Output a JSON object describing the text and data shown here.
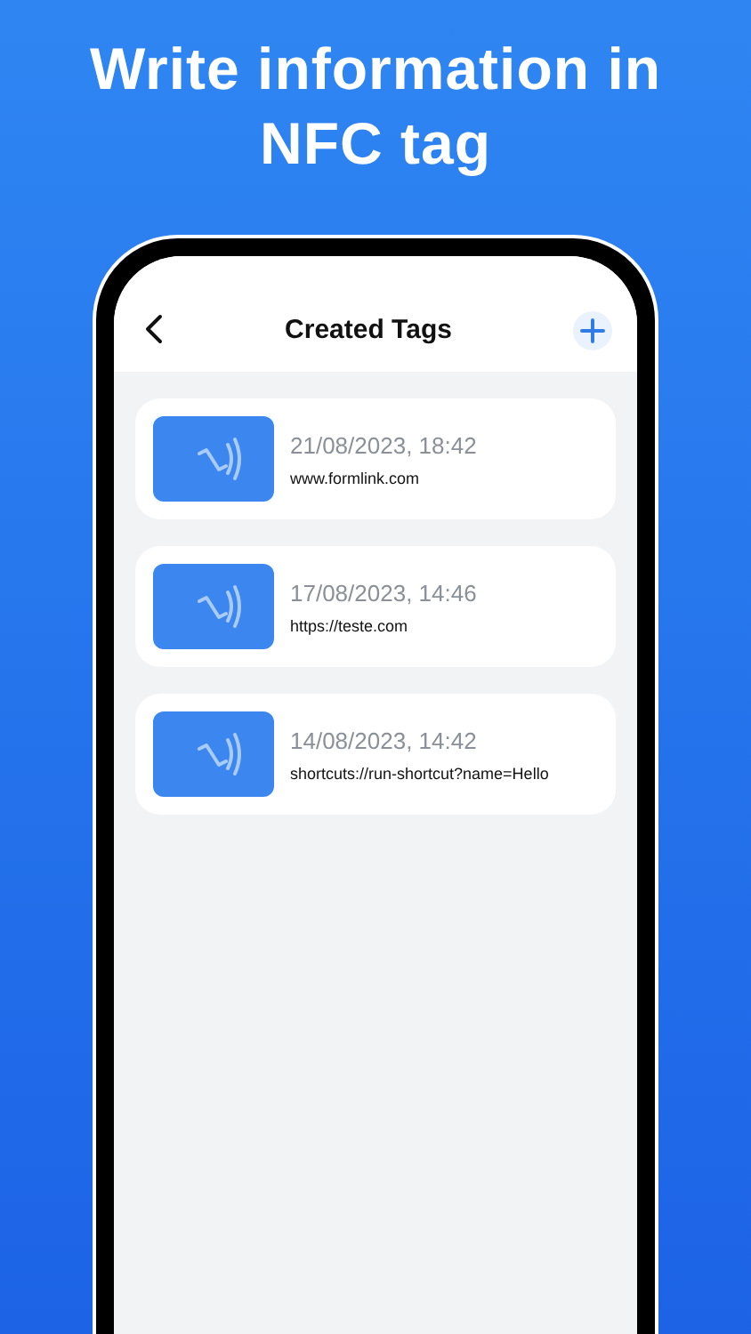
{
  "headline": "Write information in NFC tag",
  "screen": {
    "title": "Created Tags",
    "tags": [
      {
        "date": "21/08/2023, 18:42",
        "content": "www.formlink.com"
      },
      {
        "date": "17/08/2023, 14:46",
        "content": "https://teste.com"
      },
      {
        "date": "14/08/2023, 14:42",
        "content": "shortcuts://run-shortcut?name=Hello"
      }
    ]
  }
}
